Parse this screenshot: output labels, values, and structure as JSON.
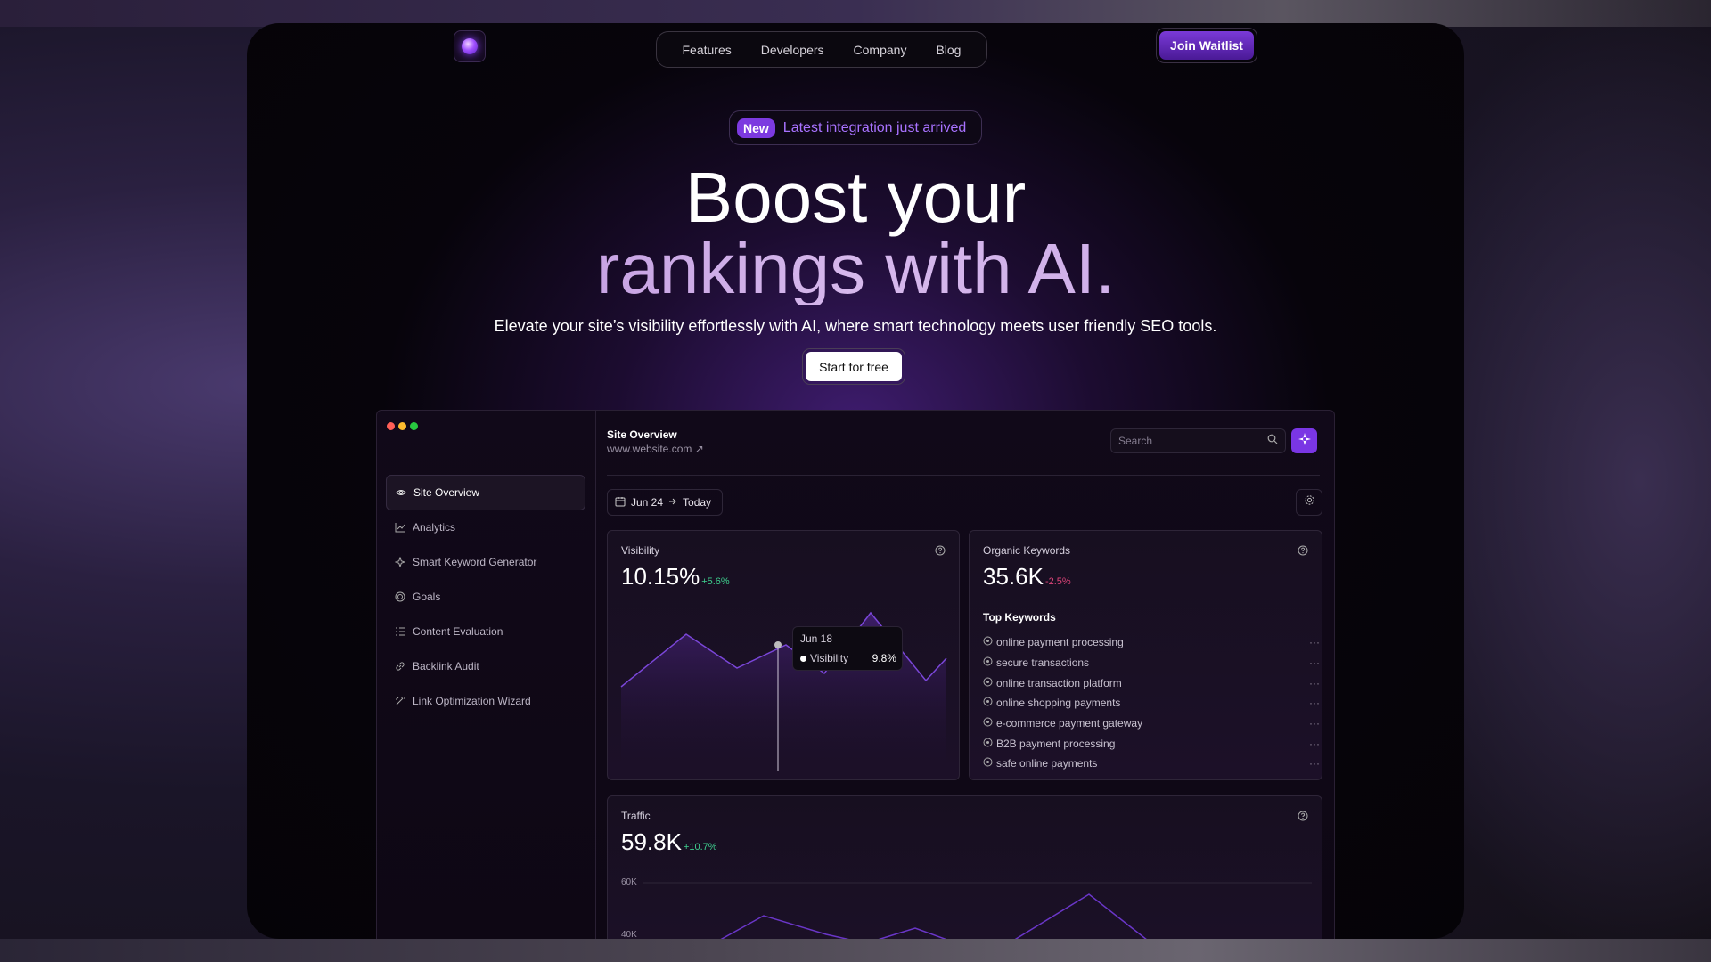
{
  "nav": {
    "links": [
      "Features",
      "Developers",
      "Company",
      "Blog"
    ],
    "cta": "Join Waitlist"
  },
  "hero": {
    "badge": "New",
    "badge_text": "Latest integration just arrived",
    "title_line1": "Boost your",
    "title_line2": "rankings with AI.",
    "subtitle": "Elevate your site’s visibility effortlessly with AI, where smart technology meets user friendly SEO tools.",
    "cta": "Start for free"
  },
  "dashboard": {
    "sidebar": [
      {
        "label": "Site Overview",
        "icon": "eye-icon",
        "active": true
      },
      {
        "label": "Analytics",
        "icon": "chart-icon"
      },
      {
        "label": "Smart Keyword Generator",
        "icon": "sparkle-icon"
      },
      {
        "label": "Goals",
        "icon": "target-icon"
      },
      {
        "label": "Content Evaluation",
        "icon": "list-icon"
      },
      {
        "label": "Backlink Audit",
        "icon": "link-icon"
      },
      {
        "label": "Link Optimization Wizard",
        "icon": "wand-icon"
      }
    ],
    "site_title": "Site Overview",
    "site_url": "www.website.com ↗",
    "search_placeholder": "Search",
    "date_from": "Jun 24",
    "date_to": "Today",
    "visibility": {
      "label": "Visibility",
      "value": "10.15%",
      "delta": "+5.6%",
      "tooltip_date": "Jun 18",
      "tooltip_series": "Visibility",
      "tooltip_value": "9.8%"
    },
    "organic": {
      "label": "Organic Keywords",
      "value": "35.6K",
      "delta": "-2.5%",
      "top_title": "Top Keywords",
      "keywords": [
        "online payment processing",
        "secure transactions",
        "online transaction platform",
        "online shopping payments",
        "e-commerce payment gateway",
        "B2B payment processing",
        "safe online payments"
      ],
      "more": "···"
    },
    "traffic": {
      "label": "Traffic",
      "value": "59.8K",
      "delta": "+10.7%",
      "y_ticks": [
        "60K",
        "40K"
      ]
    },
    "colors": {
      "accent": "#7a36e4",
      "positive": "#3ecf8e",
      "negative": "#e0457b"
    }
  }
}
